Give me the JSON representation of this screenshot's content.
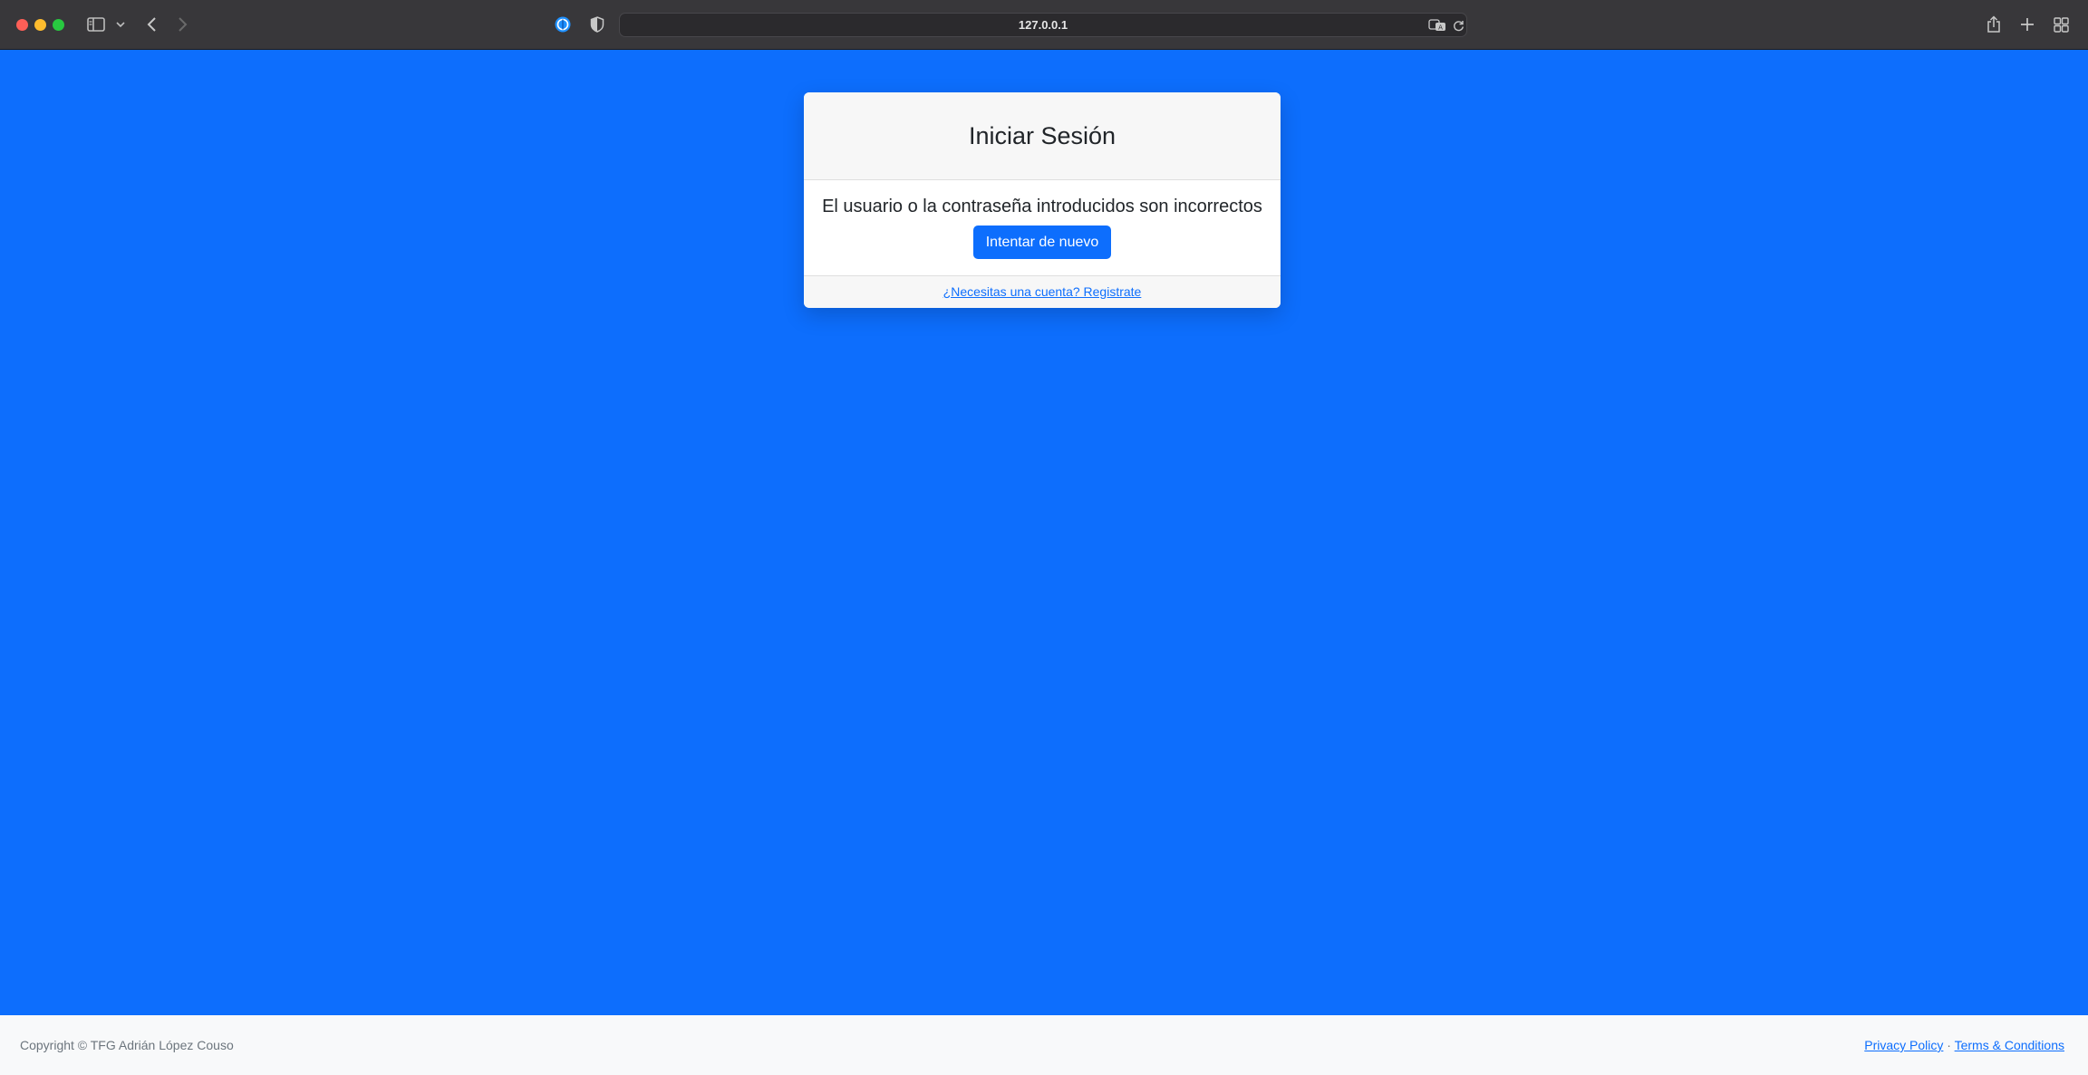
{
  "browser": {
    "url": "127.0.0.1"
  },
  "login": {
    "title": "Iniciar Sesión",
    "error_message": "El usuario o la contraseña introducidos son incorrectos",
    "retry_button": "Intentar de nuevo",
    "register_link": "¿Necesitas una cuenta? Registrate"
  },
  "footer": {
    "copyright": "Copyright © TFG Adrián López Couso",
    "privacy_link": "Privacy Policy",
    "separator": "·",
    "terms_link": "Terms & Conditions"
  },
  "colors": {
    "background": "#0d6efd",
    "primary": "#0d6efd",
    "card_header": "#f7f7f7",
    "footer_bg": "#f8f9fa"
  },
  "icons": [
    "sidebar-icon",
    "chevron-down-icon",
    "back-icon",
    "forward-icon",
    "browser-extension-icon",
    "privacy-shield-icon",
    "translate-icon",
    "reload-icon",
    "share-icon",
    "new-tab-icon",
    "tab-overview-icon"
  ]
}
